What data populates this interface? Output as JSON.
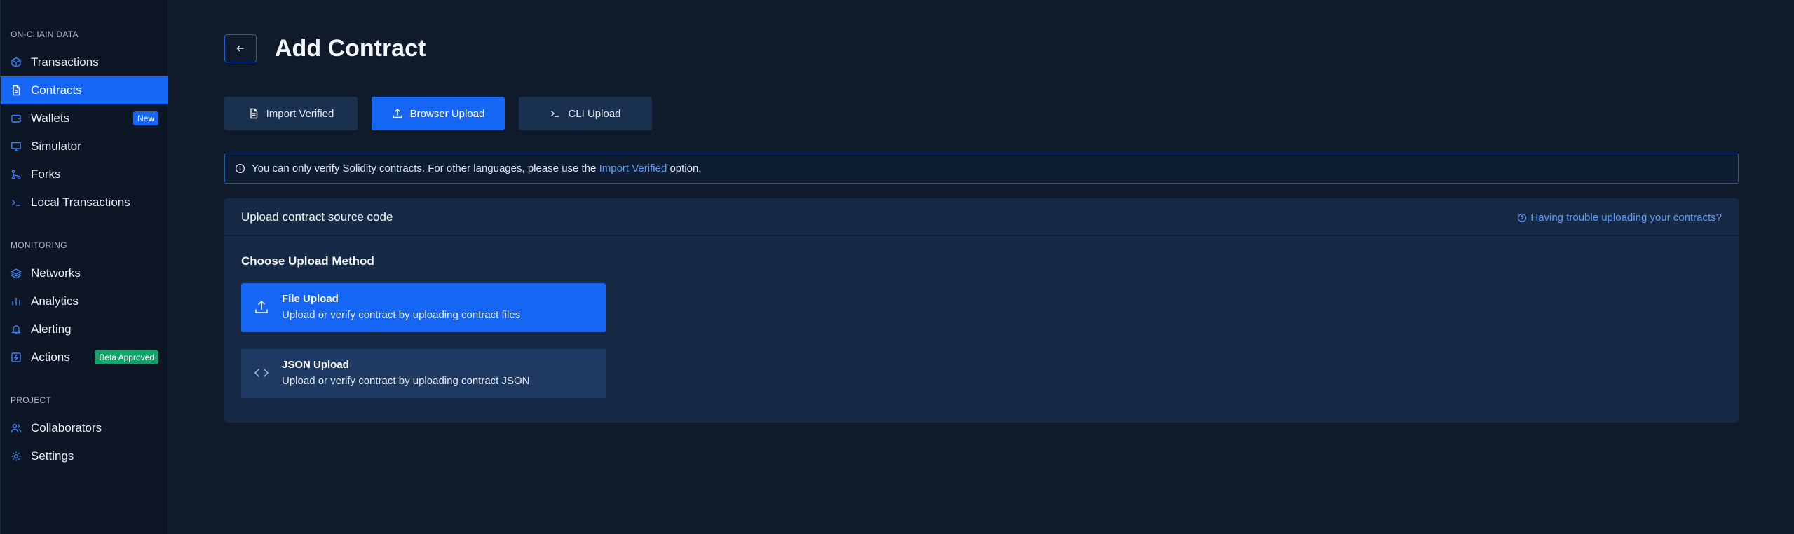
{
  "sidebar": {
    "sections": [
      {
        "title": "ON-CHAIN DATA"
      },
      {
        "title": "MONITORING"
      },
      {
        "title": "PROJECT"
      }
    ],
    "items": [
      {
        "label": "Transactions",
        "icon": "cube-icon"
      },
      {
        "label": "Contracts",
        "icon": "document-icon"
      },
      {
        "label": "Wallets",
        "icon": "wallet-icon",
        "badge": "New"
      },
      {
        "label": "Simulator",
        "icon": "monitor-icon"
      },
      {
        "label": "Forks",
        "icon": "fork-icon"
      },
      {
        "label": "Local Transactions",
        "icon": "terminal-icon"
      },
      {
        "label": "Networks",
        "icon": "layers-icon"
      },
      {
        "label": "Analytics",
        "icon": "bar-chart-icon"
      },
      {
        "label": "Alerting",
        "icon": "bell-icon"
      },
      {
        "label": "Actions",
        "icon": "lightning-icon",
        "badge": "Beta Approved"
      },
      {
        "label": "Collaborators",
        "icon": "users-icon"
      },
      {
        "label": "Settings",
        "icon": "gear-icon"
      }
    ],
    "active_item": "Contracts"
  },
  "header": {
    "title": "Add Contract"
  },
  "tabs": [
    {
      "label": "Import Verified",
      "icon": "document-icon"
    },
    {
      "label": "Browser Upload",
      "icon": "upload-icon"
    },
    {
      "label": "CLI Upload",
      "icon": "terminal-icon"
    }
  ],
  "active_tab": "Browser Upload",
  "info": {
    "text_before": "You can only verify Solidity contracts. For other languages, please use the",
    "link": "Import Verified",
    "text_after": "option."
  },
  "panel": {
    "title": "Upload contract source code",
    "help_link": "Having trouble uploading your contracts?",
    "choose_title": "Choose Upload Method",
    "methods": [
      {
        "title": "File Upload",
        "description": "Upload or verify contract by uploading contract files",
        "icon": "upload-icon"
      },
      {
        "title": "JSON Upload",
        "description": "Upload or verify contract by uploading contract JSON",
        "icon": "code-icon"
      }
    ]
  },
  "colors": {
    "accent": "#1666f5",
    "background": "#0f1a2b",
    "sidebar": "#0c1624",
    "panel": "#162a45",
    "beta_badge": "#12a36b"
  }
}
